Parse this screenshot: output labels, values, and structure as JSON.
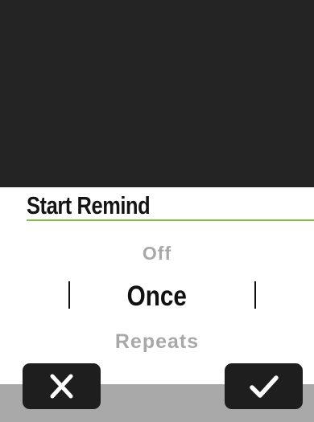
{
  "dialog": {
    "title": "Start Remind"
  },
  "picker": {
    "options": [
      "Off",
      "Once",
      "Repeats"
    ],
    "selected": "Once"
  },
  "actions": {
    "cancel_icon": "close-icon",
    "confirm_icon": "checkmark-icon"
  },
  "colors": {
    "accent": "#7cc142",
    "background_dark": "#242424",
    "button": "#1e1e1e",
    "bottom_bar": "#a9a9a9"
  }
}
